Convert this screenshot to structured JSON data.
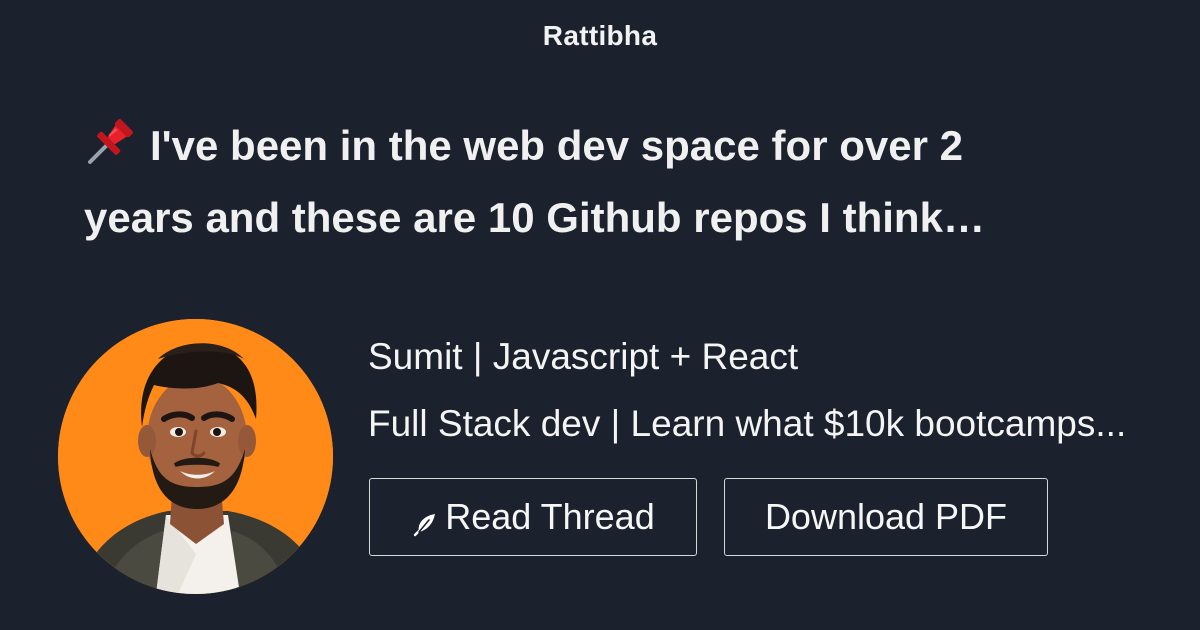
{
  "site": {
    "name": "Rattibha"
  },
  "thread": {
    "line1": "I've been in the web dev space for over 2",
    "line2": "years and these are 10 Github repos I think…",
    "pin_icon": "pushpin-icon"
  },
  "author": {
    "name": "Sumit | Javascript + React",
    "bio": "Full Stack dev | Learn what $10k bootcamps...",
    "avatar_bg": "#ff8a17"
  },
  "buttons": {
    "read_thread_label": "Read Thread",
    "read_thread_icon": "feather-icon",
    "download_pdf_label": "Download PDF"
  },
  "colors": {
    "background": "#1b212d",
    "text": "#f4f4f4",
    "button_border": "#d7d7d7"
  }
}
